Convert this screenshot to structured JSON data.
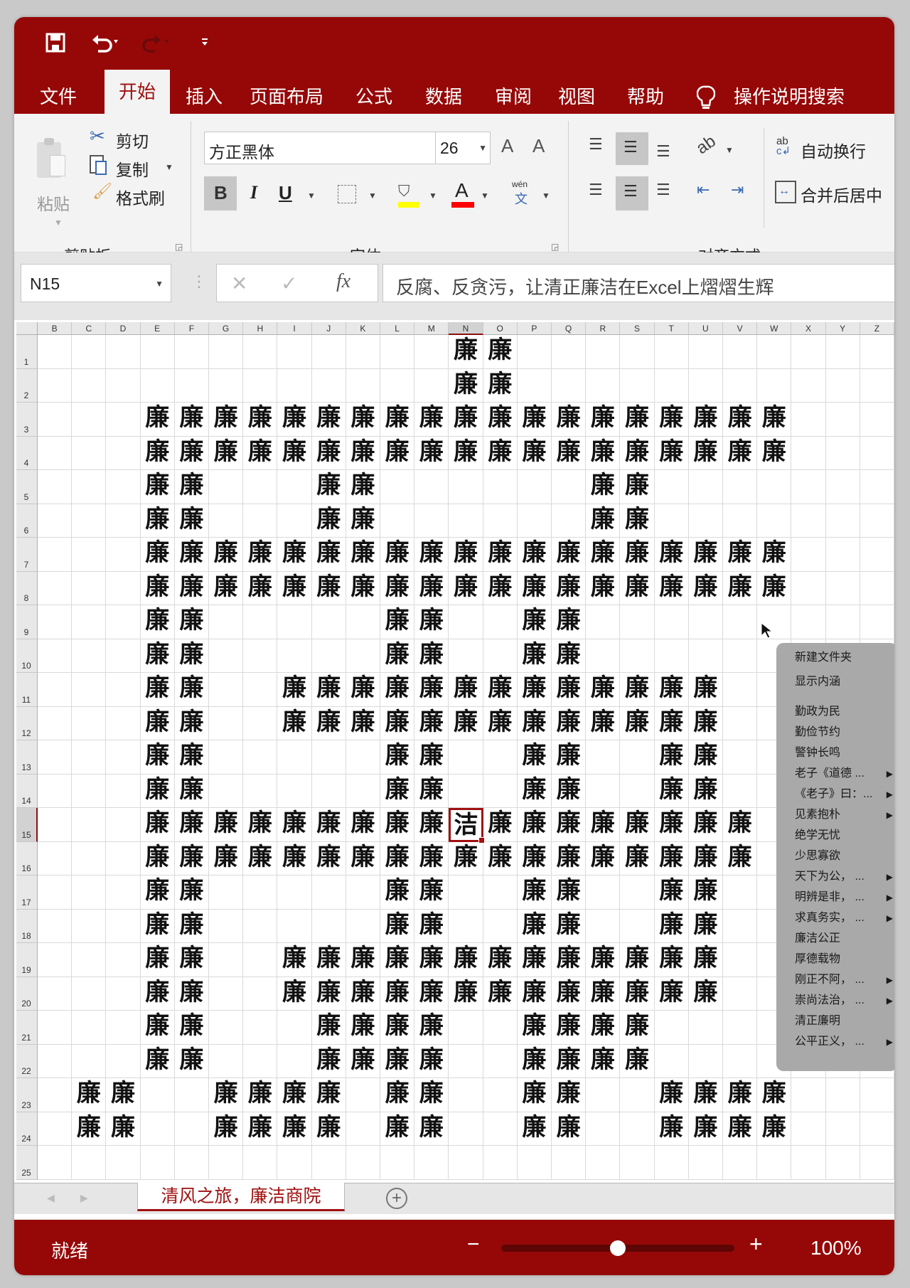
{
  "qat": {
    "save_icon": "save-icon",
    "undo_icon": "undo-icon",
    "redo_icon": "redo-icon",
    "customize_icon": "customize-qat-icon"
  },
  "tabs": [
    {
      "label": "文件"
    },
    {
      "label": "开始",
      "active": true
    },
    {
      "label": "插入"
    },
    {
      "label": "页面布局"
    },
    {
      "label": "公式"
    },
    {
      "label": "数据"
    },
    {
      "label": "审阅"
    },
    {
      "label": "视图"
    },
    {
      "label": "帮助"
    }
  ],
  "tell_me": "操作说明搜索",
  "clipboard": {
    "paste": "粘贴",
    "cut": "剪切",
    "copy": "复制",
    "format_painter": "格式刷",
    "group": "剪贴板"
  },
  "font": {
    "name": "方正黑体",
    "size": "26",
    "bold": "B",
    "italic": "I",
    "underline": "U",
    "grow": "A",
    "shrink": "A",
    "color_a": "A",
    "phonetic_top": "wén",
    "phonetic_bottom": "文",
    "group": "字体",
    "fill_color": "#ffff00",
    "font_color": "#ff0000"
  },
  "alignment": {
    "wrap": "自动换行",
    "merge": "合并后居中",
    "group": "对齐方式"
  },
  "formula_bar": {
    "name_box": "N15",
    "cancel": "✕",
    "enter": "✓",
    "fx": "fx",
    "formula": "反腐、反贪污，让清正廉洁在Excel上熠熠生辉"
  },
  "grid": {
    "columns": [
      "B",
      "C",
      "D",
      "E",
      "F",
      "G",
      "H",
      "I",
      "J",
      "K",
      "L",
      "M",
      "N",
      "O",
      "P",
      "Q",
      "R",
      "S",
      "T",
      "U",
      "V",
      "W",
      "X",
      "Y",
      "Z"
    ],
    "fill_char": "廉",
    "active_cell": {
      "col": "N",
      "row": "15",
      "text": "洁"
    },
    "rows": [
      {
        "n": "1",
        "cols": [
          "N",
          "O"
        ]
      },
      {
        "n": "2",
        "cols": [
          "N",
          "O"
        ]
      },
      {
        "n": "3",
        "cols": [
          "E",
          "F",
          "G",
          "H",
          "I",
          "J",
          "K",
          "L",
          "M",
          "N",
          "O",
          "P",
          "Q",
          "R",
          "S",
          "T",
          "U",
          "V",
          "W"
        ]
      },
      {
        "n": "4",
        "cols": [
          "E",
          "F",
          "G",
          "H",
          "I",
          "J",
          "K",
          "L",
          "M",
          "N",
          "O",
          "P",
          "Q",
          "R",
          "S",
          "T",
          "U",
          "V",
          "W"
        ]
      },
      {
        "n": "5",
        "cols": [
          "E",
          "F",
          "J",
          "K",
          "R",
          "S"
        ]
      },
      {
        "n": "6",
        "cols": [
          "E",
          "F",
          "J",
          "K",
          "R",
          "S"
        ]
      },
      {
        "n": "7",
        "cols": [
          "E",
          "F",
          "G",
          "H",
          "I",
          "J",
          "K",
          "L",
          "M",
          "N",
          "O",
          "P",
          "Q",
          "R",
          "S",
          "T",
          "U",
          "V",
          "W"
        ]
      },
      {
        "n": "8",
        "cols": [
          "E",
          "F",
          "G",
          "H",
          "I",
          "J",
          "K",
          "L",
          "M",
          "N",
          "O",
          "P",
          "Q",
          "R",
          "S",
          "T",
          "U",
          "V",
          "W"
        ]
      },
      {
        "n": "9",
        "cols": [
          "E",
          "F",
          "L",
          "M",
          "P",
          "Q"
        ]
      },
      {
        "n": "10",
        "cols": [
          "E",
          "F",
          "L",
          "M",
          "P",
          "Q"
        ]
      },
      {
        "n": "11",
        "cols": [
          "E",
          "F",
          "I",
          "J",
          "K",
          "L",
          "M",
          "N",
          "O",
          "P",
          "Q",
          "R",
          "S",
          "T",
          "U"
        ]
      },
      {
        "n": "12",
        "cols": [
          "E",
          "F",
          "I",
          "J",
          "K",
          "L",
          "M",
          "N",
          "O",
          "P",
          "Q",
          "R",
          "S",
          "T",
          "U"
        ]
      },
      {
        "n": "13",
        "cols": [
          "E",
          "F",
          "L",
          "M",
          "P",
          "Q",
          "T",
          "U"
        ]
      },
      {
        "n": "14",
        "cols": [
          "E",
          "F",
          "L",
          "M",
          "P",
          "Q",
          "T",
          "U"
        ]
      },
      {
        "n": "15",
        "cols": [
          "E",
          "F",
          "G",
          "H",
          "I",
          "J",
          "K",
          "L",
          "M",
          "O",
          "P",
          "Q",
          "R",
          "S",
          "T",
          "U",
          "V"
        ]
      },
      {
        "n": "16",
        "cols": [
          "E",
          "F",
          "G",
          "H",
          "I",
          "J",
          "K",
          "L",
          "M",
          "N",
          "O",
          "P",
          "Q",
          "R",
          "S",
          "T",
          "U",
          "V"
        ]
      },
      {
        "n": "17",
        "cols": [
          "E",
          "F",
          "L",
          "M",
          "P",
          "Q",
          "T",
          "U"
        ]
      },
      {
        "n": "18",
        "cols": [
          "E",
          "F",
          "L",
          "M",
          "P",
          "Q",
          "T",
          "U"
        ]
      },
      {
        "n": "19",
        "cols": [
          "E",
          "F",
          "I",
          "J",
          "K",
          "L",
          "M",
          "N",
          "O",
          "P",
          "Q",
          "R",
          "S",
          "T",
          "U"
        ]
      },
      {
        "n": "20",
        "cols": [
          "E",
          "F",
          "I",
          "J",
          "K",
          "L",
          "M",
          "N",
          "O",
          "P",
          "Q",
          "R",
          "S",
          "T",
          "U"
        ]
      },
      {
        "n": "21",
        "cols": [
          "E",
          "F",
          "J",
          "K",
          "L",
          "M",
          "P",
          "Q",
          "R",
          "S"
        ]
      },
      {
        "n": "22",
        "cols": [
          "E",
          "F",
          "J",
          "K",
          "L",
          "M",
          "P",
          "Q",
          "R",
          "S"
        ]
      },
      {
        "n": "23",
        "cols": [
          "C",
          "D",
          "G",
          "H",
          "I",
          "J",
          "L",
          "M",
          "P",
          "Q",
          "T",
          "U",
          "V",
          "W"
        ]
      },
      {
        "n": "24",
        "cols": [
          "C",
          "D",
          "G",
          "H",
          "I",
          "J",
          "L",
          "M",
          "P",
          "Q",
          "T",
          "U",
          "V",
          "W"
        ]
      },
      {
        "n": "25",
        "cols": []
      }
    ]
  },
  "context_menu": [
    {
      "label": "新建文件夹",
      "submenu": false
    },
    {
      "label": "显示内涵",
      "submenu": false
    },
    {
      "label": "勤政为民",
      "submenu": false
    },
    {
      "label": "勤俭节约",
      "submenu": false
    },
    {
      "label": "警钟长鸣",
      "submenu": false
    },
    {
      "label": "老子《道德 ...",
      "submenu": true
    },
    {
      "label": "《老子》曰：...",
      "submenu": true
    },
    {
      "label": "见素抱朴",
      "submenu": true
    },
    {
      "label": "绝学无忧",
      "submenu": false
    },
    {
      "label": "少思寡欲",
      "submenu": false
    },
    {
      "label": "天下为公， ...",
      "submenu": true
    },
    {
      "label": "明辨是非， ...",
      "submenu": true
    },
    {
      "label": "求真务实， ...",
      "submenu": true
    },
    {
      "label": "廉洁公正",
      "submenu": false
    },
    {
      "label": "厚德载物",
      "submenu": false
    },
    {
      "label": "刚正不阿， ...",
      "submenu": true
    },
    {
      "label": "崇尚法治， ...",
      "submenu": true
    },
    {
      "label": "清正廉明",
      "submenu": false
    },
    {
      "label": "公平正义， ...",
      "submenu": true
    }
  ],
  "submenu_arrow": "▶",
  "sheet": {
    "tab": "清风之旅，廉洁商院",
    "add": "+",
    "prev": "◀",
    "next": "▶"
  },
  "status": {
    "ready": "就绪",
    "zoom_out": "−",
    "zoom_in": "+",
    "zoom": "100%",
    "zoom_fraction": 0.5
  },
  "colors": {
    "brand": "#960808",
    "accent": "#a01010",
    "menu": "#a9a9a9"
  }
}
